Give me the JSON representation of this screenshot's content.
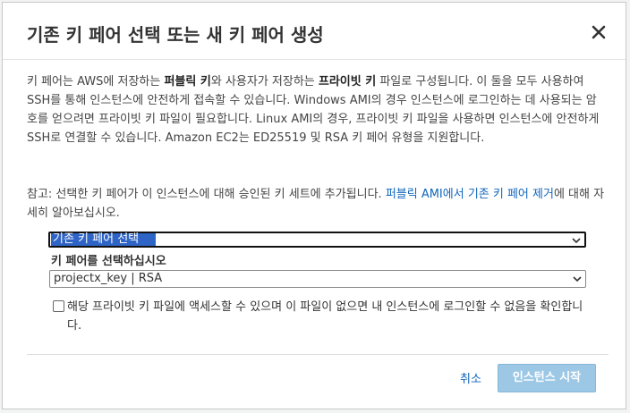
{
  "dialog": {
    "title": "기존 키 페어 선택 또는 새 키 페어 생성",
    "close_icon": "close-icon"
  },
  "description": {
    "part1": "키 페어는 AWS에 저장하는 ",
    "bold1": "퍼블릭 키",
    "part2": "와 사용자가 저장하는 ",
    "bold2": "프라이빗 키",
    "part3": " 파일로 구성됩니다. 이 둘을 모두 사용하여 SSH를 통해 인스턴스에 안전하게 접속할 수 있습니다. Windows AMI의 경우 인스턴스에 로그인하는 데 사용되는 암호를 얻으려면 프라이빗 키 파일이 필요합니다. Linux AMI의 경우, 프라이빗 키 파일을 사용하면 인스턴스에 안전하게 SSH로 연결할 수 있습니다. Amazon EC2는 ED25519 및 RSA 키 페어 유형을 지원합니다."
  },
  "note": {
    "text": "참고: 선택한 키 페어가 이 인스턴스에 대해 승인된 키 세트에 추가됩니다. ",
    "link": "퍼블릭 AMI에서 기존 키 페어 제거",
    "suffix": "에 대해 자세히 알아보십시오."
  },
  "key_pair_mode_select": {
    "value": "기존 키 페어 선택"
  },
  "key_pair_select": {
    "label": "키 페어를 선택하십시오",
    "value": "projectx_key | RSA"
  },
  "acknowledge": {
    "checked": false,
    "text": "해당 프라이빗 키 파일에 액세스할 수 있으며 이 파일이 없으면 내 인스턴스에 로그인할 수 없음을 확인합니다."
  },
  "footer": {
    "cancel_label": "취소",
    "launch_label": "인스턴스 시작"
  },
  "colors": {
    "link": "#1166bb",
    "primary_button_disabled": "#9cc8e6",
    "selection_highlight": "#2f64c7"
  }
}
